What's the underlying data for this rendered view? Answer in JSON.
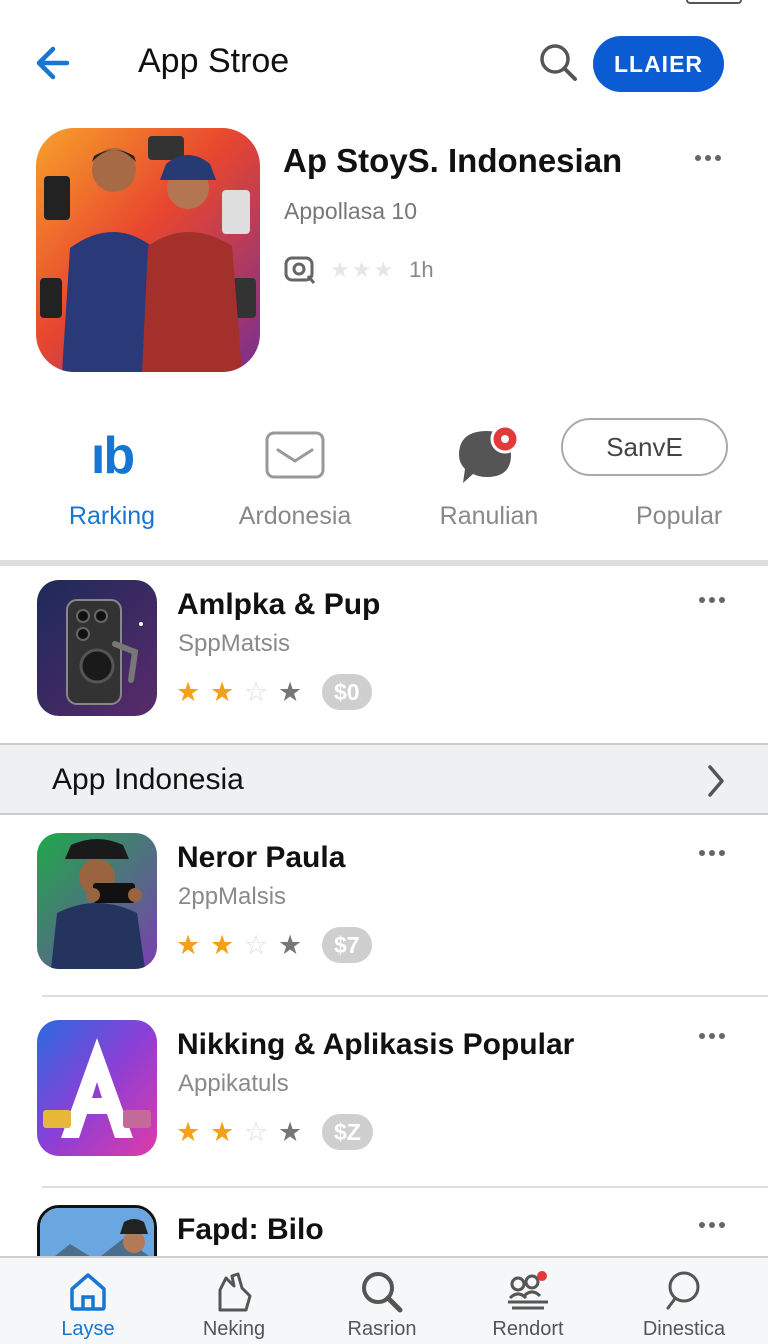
{
  "header": {
    "title": "App Stroe",
    "login_label": "LLAIER"
  },
  "featured": {
    "title": "Ap StoyS. Indonesian",
    "subtitle": "Appollasa 10",
    "rating_text": "1h"
  },
  "categories": [
    {
      "label": "Rarking",
      "glyph": "ıb",
      "active": true
    },
    {
      "label": "Ardonesia"
    },
    {
      "label": "Ranulian"
    },
    {
      "label": "Popular"
    }
  ],
  "save_label": "SanvE",
  "apps": [
    {
      "name": "Amlpka & Pup",
      "developer": "SppMatsis",
      "rating": 2,
      "price": "$0"
    },
    {
      "name": "Neror Paula",
      "developer": "2ppMalsis",
      "rating": 2,
      "price": "$7"
    },
    {
      "name": "Nikking & Aplikasis Popular",
      "developer": "Appikatuls",
      "rating": 2,
      "price": "$Z"
    },
    {
      "name": "Fapd: Bilo"
    }
  ],
  "section": {
    "title": "App Indonesia"
  },
  "bottom_nav": [
    {
      "label": "Layse",
      "icon": "home-icon",
      "active": true
    },
    {
      "label": "Neking",
      "icon": "hand-icon"
    },
    {
      "label": "Rasrion",
      "icon": "search-icon"
    },
    {
      "label": "Rendort",
      "icon": "people-icon"
    },
    {
      "label": "Dinestica",
      "icon": "search-icon"
    }
  ],
  "colors": {
    "accent": "#1676d2",
    "button": "#0b5bd3",
    "star": "#f5a018"
  }
}
